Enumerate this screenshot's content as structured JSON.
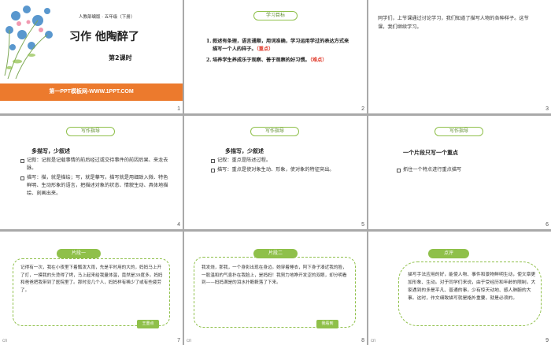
{
  "slides": [
    {
      "num": "1",
      "subtitle": "人教部编版 · 五年级（下册）",
      "title": "习作 他陶醉了",
      "lesson": "第2课时",
      "banner": "第一PPT模板网-WWW.1PPT.COM"
    },
    {
      "num": "2",
      "pill": "学习目标",
      "items": [
        {
          "index": "1.",
          "text": "叙述有条理，语言通顺，用词准确，学习运用学过的表达方式来描写一个人的样子。",
          "tag": "（重点）"
        },
        {
          "index": "2.",
          "text": "培养学生养成乐于观察、善于观察的好习惯。",
          "tag": "（难点）"
        }
      ]
    },
    {
      "num": "3",
      "text": "同学们，上节课通过讨论学习，我们知道了描写人物的各种样子。这节课，我们继续学习。"
    },
    {
      "num": "4",
      "pill": "写作指导",
      "heading": "多描写，少叙述",
      "bullets": [
        "记叙：记叙是记载事情的前后经过或交待事件的前因后果、来龙去脉。",
        "描写：描，就是描绘；写，就是摹写。描写就是用细致入微、特色鲜明、生动形象的语言，把描述对象的状态、情貌生动、具体地描绘、刻画出来。"
      ]
    },
    {
      "num": "5",
      "pill": "写作指导",
      "heading": "多描写，少叙述",
      "bullets": [
        "记叙：重点是陈述过程。",
        "描写：重点是使对象生动、形象，使对象的特征突出。"
      ]
    },
    {
      "num": "6",
      "pill": "写作指导",
      "heading": "一个片段只写一个重点",
      "bullets": [
        "抓住一个特点进行重点描写"
      ]
    },
    {
      "num": "7",
      "hash": "cn",
      "pill": "片段一",
      "text": "记得有一次，我在小夜里下着瓢泼大雨，先是平时用的大的，妈妈马上开了灯，一摸我的头烫得了烤，马上起来给我量体温，竟然是39度多。妈妈和爸爸把我带到了医院里了。那时没几个人，妈妈样有稀少了或有些疲劳了。",
      "corner": "王重点"
    },
    {
      "num": "8",
      "hash": "cn",
      "pill": "片段二",
      "text": "我发烧，那我，一个身影出现在身边。她穿着睡衣，阿下身子凑近我的脸，一股温和的气息扑在我脸上，是妈妈！我努力地睁开发涩的双眼，却分明看到——妈妈满是的泪水扑簌簌落了下来。",
      "corner": "我看到"
    },
    {
      "num": "9",
      "hash": "cn",
      "pill": "点评",
      "text": "描写手法应用的好，能使人物、事件和景物鲜明生动，使文章更加形象、生动。对于同学们来说，由于受经历和年龄的限制，大家遇到的多是平凡、普通的事，少有惊天动地、感人肺腑的大事。这时，作文细致描写就是格外重要，就是必须的。"
    }
  ]
}
